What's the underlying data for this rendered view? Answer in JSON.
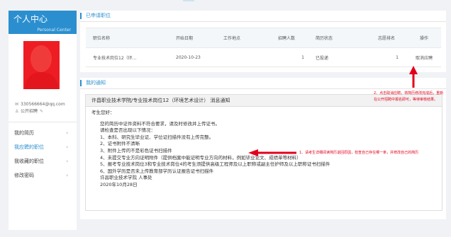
{
  "sidebar": {
    "title": "个人中心",
    "subtitle": "Personal Center",
    "email": "330566664@qq.com",
    "public_label": "公开招聘",
    "menu": [
      {
        "label": "我的简历",
        "active": false
      },
      {
        "label": "我应聘的职位",
        "active": true
      },
      {
        "label": "我收藏的职位",
        "active": false
      },
      {
        "label": "修改密码",
        "active": false
      }
    ]
  },
  "applied_jobs": {
    "title": "已申请职位",
    "headers": [
      "职位名称",
      "开始日期",
      "工作地点",
      "招聘人数",
      "简历状态",
      "志愿排名",
      "操作"
    ],
    "rows": [
      {
        "name": "专业技术岗位12（环...",
        "start": "2020-10-23",
        "location": "",
        "count": "1",
        "status": "已投递",
        "rank": "1",
        "action": "取消应聘"
      }
    ]
  },
  "notice_section": {
    "title": "我的通知",
    "notice_title": "许昌职业技术学院/专业技术岗位12（环境艺术设计）  消息通知",
    "greeting": "考生您好：",
    "lines": [
      "您的简历中证件资料不符合要求，请及时修改并上传证书。",
      "请检查是否出现以下情况：",
      "1、本科、研究生毕业证、学位证扫描件没有上传完整。",
      "2、证书附件不清晰",
      "3、附件上传的不是彩色证书扫描件",
      "4、未提交专业方向证明附件（提供档案中能证明专业方向的材料，例如毕业论文、成绩单等材料）",
      "5、报考专业技术岗位3和专业技术岗位4的考生须提供高级工程师及以上职称或副主任护师及以上职称证书扫描件",
      "6、国外学历是否未上传教育部学历认证报告证书扫描件"
    ],
    "signature": "许昌职业技术学院 人事处",
    "date": "2020年10月28日"
  },
  "annotations": {
    "cancel_note_line1": "2、点击取消应聘，将简历修改完成后，重新",
    "cancel_note_line2": "在公开招聘中报名即可，等待审核结果。",
    "notice_note": "1、请考生详细阅读简历退回原因，检查自己存在哪一条，并修改自己的简历"
  },
  "colors": {
    "accent": "#2b8fcf",
    "annotation": "#e3001b"
  }
}
